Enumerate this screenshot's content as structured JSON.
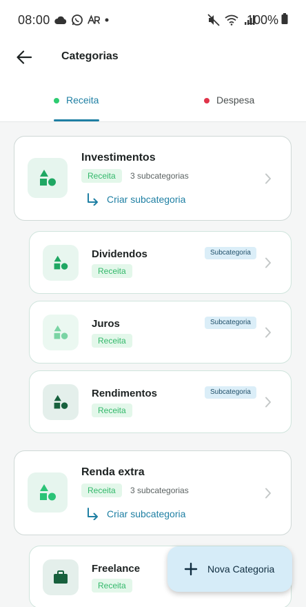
{
  "status_bar": {
    "time": "08:00",
    "battery": "100%",
    "left_icons": [
      "cloud-icon",
      "whatsapp-icon",
      "ar-icon",
      "dot-icon"
    ],
    "right_icons": [
      "mute-icon",
      "wifi-icon",
      "signal-icon",
      "battery-icon"
    ]
  },
  "header": {
    "title": "Categorias"
  },
  "tabs": [
    {
      "label": "Receita",
      "color": "#2ecc71",
      "active": true
    },
    {
      "label": "Despesa",
      "color": "#e0344a",
      "active": false
    }
  ],
  "categories": [
    {
      "name": "Investimentos",
      "type": "Receita",
      "subcount": "3 subcategorias",
      "create_label": "Criar subcategoria",
      "icon": "shapes-icon",
      "subcategories": [
        {
          "name": "Dividendos",
          "type": "Receita",
          "badge": "Subcategoria",
          "icon": "shapes-icon"
        },
        {
          "name": "Juros",
          "type": "Receita",
          "badge": "Subcategoria",
          "icon": "shapes-icon"
        },
        {
          "name": "Rendimentos",
          "type": "Receita",
          "badge": "Subcategoria",
          "icon": "shapes-icon"
        }
      ]
    },
    {
      "name": "Renda extra",
      "type": "Receita",
      "subcount": "3 subcategorias",
      "create_label": "Criar subcategoria",
      "icon": "shapes-icon",
      "subcategories": [
        {
          "name": "Freelance",
          "type": "Receita",
          "icon": "briefcase-icon"
        }
      ]
    }
  ],
  "fab": {
    "label": "Nova Categoria",
    "icon": "plus-icon"
  },
  "colors": {
    "accent": "#1e7fa3",
    "income_green": "#2ecc71",
    "icon_green": "#1fa763",
    "chip_bg": "#e3f7ea",
    "badge_bg": "#dbeef8"
  }
}
